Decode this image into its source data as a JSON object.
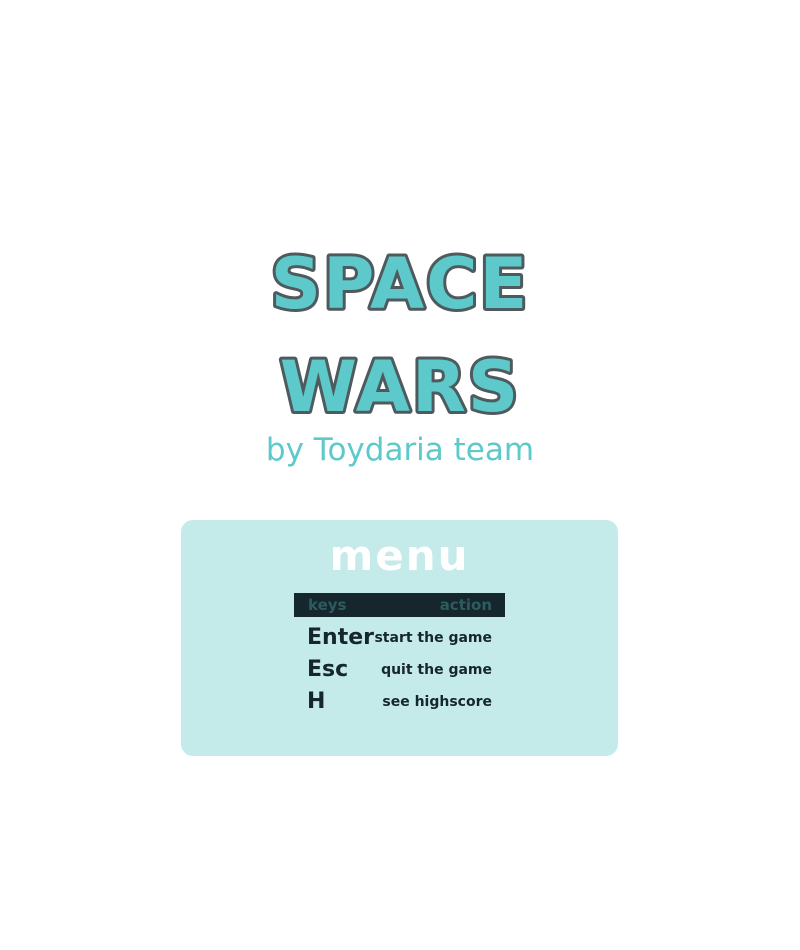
{
  "logo": {
    "line1": "SPACE",
    "line2": "WARS"
  },
  "subtitle": "by Toydaria team",
  "menu": {
    "title": "menu",
    "header": {
      "keys": "keys",
      "action": "action"
    },
    "rows": [
      {
        "key": "Enter",
        "action": "start the game"
      },
      {
        "key": "Esc",
        "action": "quit the game"
      },
      {
        "key": "H",
        "action": "see highscore"
      }
    ]
  },
  "colors": {
    "accent": "#5dc9cb",
    "outline": "#4e5b5e",
    "panel": "#c4eaea",
    "dark": "#16262d"
  }
}
